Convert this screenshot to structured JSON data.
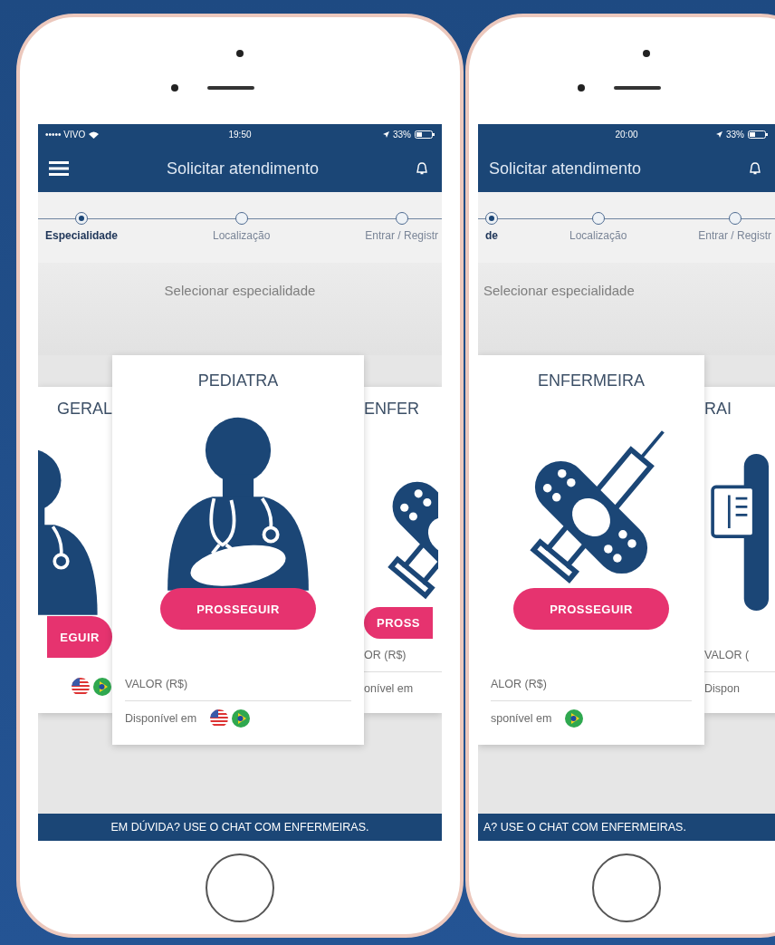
{
  "phones": [
    {
      "status_bar": {
        "carrier": "••••• VIVO",
        "time": "19:50",
        "battery": "33%"
      },
      "header": {
        "title": "Solicitar atendimento",
        "menu": true
      },
      "steps": [
        {
          "label": "Especialidade",
          "selected": true
        },
        {
          "label": "Localização",
          "selected": false
        },
        {
          "label": "Entrar / Registr",
          "selected": false
        }
      ],
      "prompt": "Selecionar especialidade",
      "cards": [
        {
          "kind": "doctor",
          "selected": false,
          "title": "GERAL",
          "button": "EGUIR",
          "flags": [
            {
              "kind": "us"
            },
            {
              "kind": "br"
            }
          ]
        },
        {
          "kind": "pediatrician",
          "selected": true,
          "title": "PEDIATRA",
          "button": "PROSSEGUIR",
          "value_label": "VALOR (R$)",
          "available_label": "Disponível em",
          "flags": [
            {
              "kind": "us"
            },
            {
              "kind": "br"
            }
          ]
        },
        {
          "kind": "nurse",
          "selected": false,
          "title": "ENFER",
          "button": "PROSS",
          "value_label": "OR (R$)",
          "available_label": "onível em"
        }
      ],
      "footer": "EM DÚVIDA? USE O CHAT COM ENFERMEIRAS."
    },
    {
      "status_bar": {
        "time": "20:00",
        "battery": "33%"
      },
      "header": {
        "title": "Solicitar atendimento",
        "menu": false
      },
      "steps": [
        {
          "label": "de",
          "selected": true
        },
        {
          "label": "Localização",
          "selected": false
        },
        {
          "label": "Entrar / Registr",
          "selected": false
        }
      ],
      "prompt": "Selecionar especialidade",
      "cards": [
        {
          "kind": "nurse",
          "selected": true,
          "title": "ENFERMEIRA",
          "button": "PROSSEGUIR",
          "value_label": "ALOR (R$)",
          "available_label": "sponível em",
          "flags": [
            {
              "kind": "br"
            }
          ]
        },
        {
          "kind": "xray",
          "selected": false,
          "title": "RAI",
          "value_label": "VALOR (",
          "available_label": "Dispon"
        }
      ],
      "footer": "A? USE O CHAT COM ENFERMEIRAS."
    }
  ]
}
